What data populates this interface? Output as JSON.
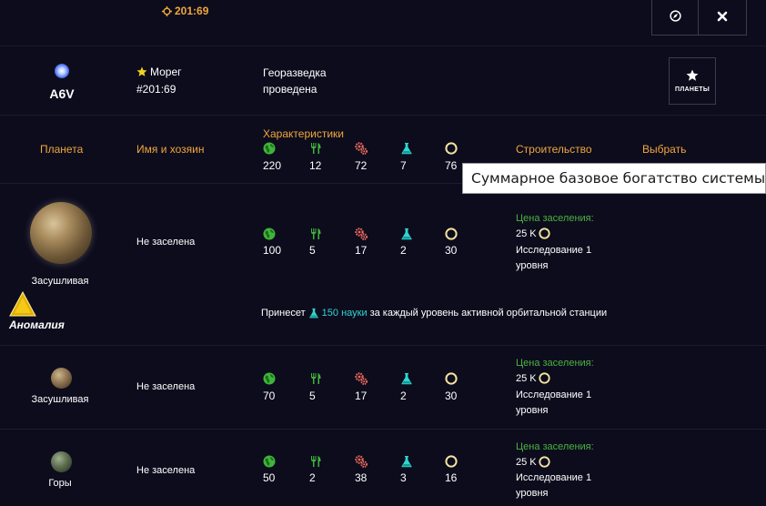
{
  "header": {
    "coords": "201:69",
    "target_icon": "crosshair-icon",
    "compass_icon": "compass-icon",
    "close_icon": "close-icon"
  },
  "system": {
    "star_class": "A6V",
    "owner_name": "Морег",
    "owner_coords": "#201:69",
    "survey_line1": "Георазведка",
    "survey_line2": "проведена",
    "planets_button": "ПЛАНЕТЫ"
  },
  "columns": {
    "planet": "Планета",
    "name_owner": "Имя и хозяин",
    "characteristics": "Характеристики",
    "build": "Строительство",
    "select": "Выбрать"
  },
  "totals": {
    "metal": "220",
    "food": "12",
    "production": "72",
    "science": "7",
    "wealth": "76"
  },
  "tooltip": "Суммарное базовое богатство системы",
  "icons": [
    "globe-icon",
    "fork-knife-icon",
    "gears-icon",
    "flask-icon",
    "ring-icon"
  ],
  "planets": [
    {
      "type": "Засушливая",
      "status": "Не заселена",
      "values": {
        "metal": "100",
        "food": "5",
        "production": "17",
        "science": "2",
        "wealth": "30"
      },
      "price_label": "Цена заселения:",
      "price": "25 K",
      "research_line1": "Исследование 1",
      "research_line2": "уровня",
      "anomaly_label": "Аномалия",
      "bonus_prefix": "Принесет",
      "bonus_value": "150 науки",
      "bonus_suffix": "за каждый уровень активной орбитальной станции"
    },
    {
      "type": "Засушливая",
      "status": "Не заселена",
      "values": {
        "metal": "70",
        "food": "5",
        "production": "17",
        "science": "2",
        "wealth": "30"
      },
      "price_label": "Цена заселения:",
      "price": "25 K",
      "research_line1": "Исследование 1",
      "research_line2": "уровня"
    },
    {
      "type": "Горы",
      "status": "Не заселена",
      "values": {
        "metal": "50",
        "food": "2",
        "production": "38",
        "science": "3",
        "wealth": "16"
      },
      "price_label": "Цена заселения:",
      "price": "25 K",
      "research_line1": "Исследование 1",
      "research_line2": "уровня"
    }
  ],
  "colors": {
    "background": "#0d0c1d",
    "accent_orange": "#f0a73a",
    "price_green": "#4ab33e",
    "science_cyan": "#2fd6d0"
  }
}
